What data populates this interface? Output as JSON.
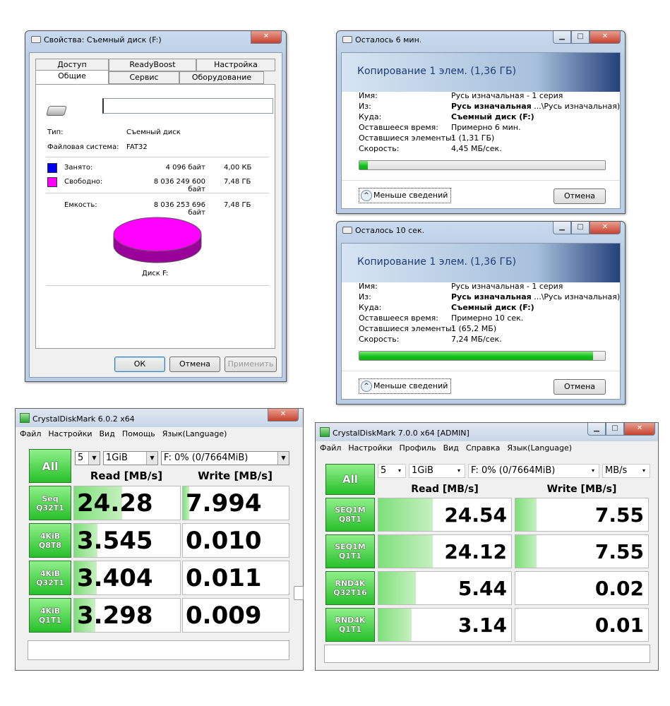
{
  "props": {
    "title": "Свойства: Съемный диск (F:)",
    "tabs_top": [
      "Доступ",
      "ReadyBoost",
      "Настройка"
    ],
    "tabs_bottom": [
      "Общие",
      "Сервис",
      "Оборудование"
    ],
    "name_value": "",
    "type_label": "Тип:",
    "type_value": "Съемный диск",
    "fs_label": "Файловая система:",
    "fs_value": "FAT32",
    "used_label": "Занято:",
    "used_bytes": "4 096 байт",
    "used_size": "4,00 КБ",
    "free_label": "Свободно:",
    "free_bytes": "8 036 249 600 байт",
    "free_size": "7,48 ГБ",
    "cap_label": "Емкость:",
    "cap_bytes": "8 036 253 696 байт",
    "cap_size": "7,48 ГБ",
    "disk_label": "Диск F:",
    "ok": "ОК",
    "cancel": "Отмена",
    "apply": "Применить",
    "used_color": "#0000ee",
    "free_color": "#ff00ff"
  },
  "copy1": {
    "title": "Осталось 6 мин.",
    "header": "Копирование 1 элем. (1,36 ГБ)",
    "name_label": "Имя:",
    "name_value": "Русь изначальная - 1 серия",
    "from_label": "Из:",
    "from_bold": "Русь изначальная",
    "from_rest": " ...\\Русь изначальная)",
    "to_label": "Куда:",
    "to_value": "Съемный диск (F:)",
    "time_label": "Оставшееся время:",
    "time_value": "Примерно 6 мин.",
    "items_label": "Оставшиеся элементы:",
    "items_value": "1 (1,31 ГБ)",
    "speed_label": "Скорость:",
    "speed_value": "4,45 МБ/сек.",
    "progress": 0.035,
    "less": "Меньше сведений",
    "cancel": "Отмена"
  },
  "copy2": {
    "title": "Осталось 10 сек.",
    "header": "Копирование 1 элем. (1,36 ГБ)",
    "name_label": "Имя:",
    "name_value": "Русь изначальная - 1 серия",
    "from_label": "Из:",
    "from_bold": "Русь изначальная",
    "from_rest": " ...\\Русь изначальная)",
    "to_label": "Куда:",
    "to_value": "Съемный диск (F:)",
    "time_label": "Оставшееся время:",
    "time_value": "Примерно 10 сек.",
    "items_label": "Оставшиеся элементы:",
    "items_value": "1 (65,2 МБ)",
    "speed_label": "Скорость:",
    "speed_value": "7,24 МБ/сек.",
    "progress": 0.95,
    "less": "Меньше сведений",
    "cancel": "Отмена"
  },
  "cdm6": {
    "title": "CrystalDiskMark 6.0.2 x64",
    "menu": [
      "Файл",
      "Настройки",
      "Вид",
      "Помощь",
      "Язык(Language)"
    ],
    "all": "All",
    "count": "5",
    "size": "1GiB",
    "drive": "F: 0% (0/7664MiB)",
    "read_hdr": "Read [MB/s]",
    "write_hdr": "Write [MB/s]",
    "rows": [
      {
        "l1": "Seq",
        "l2": "Q32T1",
        "read": "24.28",
        "write": "7.994",
        "rfill": 0.45,
        "wfill": 0.06
      },
      {
        "l1": "4KiB",
        "l2": "Q8T8",
        "read": "3.545",
        "write": "0.010",
        "rfill": 0.22,
        "wfill": 0.0
      },
      {
        "l1": "4KiB",
        "l2": "Q32T1",
        "read": "3.404",
        "write": "0.011",
        "rfill": 0.21,
        "wfill": 0.0
      },
      {
        "l1": "4KiB",
        "l2": "Q1T1",
        "read": "3.298",
        "write": "0.009",
        "rfill": 0.2,
        "wfill": 0.0
      }
    ]
  },
  "cdm7": {
    "title": "CrystalDiskMark 7.0.0 x64 [ADMIN]",
    "menu": [
      "Файл",
      "Настройки",
      "Профиль",
      "Вид",
      "Справка",
      "Язык(Language)"
    ],
    "all": "All",
    "count": "5",
    "size": "1GiB",
    "drive": "F: 0% (0/7664MiB)",
    "unit": "MB/s",
    "read_hdr": "Read [MB/s]",
    "write_hdr": "Write [MB/s]",
    "rows": [
      {
        "l1": "SEQ1M",
        "l2": "Q8T1",
        "read": "24.54",
        "write": "7.55",
        "rfill": 0.41,
        "wfill": 0.16
      },
      {
        "l1": "SEQ1M",
        "l2": "Q1T1",
        "read": "24.12",
        "write": "7.55",
        "rfill": 0.41,
        "wfill": 0.16
      },
      {
        "l1": "RND4K",
        "l2": "Q32T16",
        "read": "5.44",
        "write": "0.02",
        "rfill": 0.28,
        "wfill": 0.0
      },
      {
        "l1": "RND4K",
        "l2": "Q1T1",
        "read": "3.14",
        "write": "0.01",
        "rfill": 0.25,
        "wfill": 0.0
      }
    ]
  }
}
